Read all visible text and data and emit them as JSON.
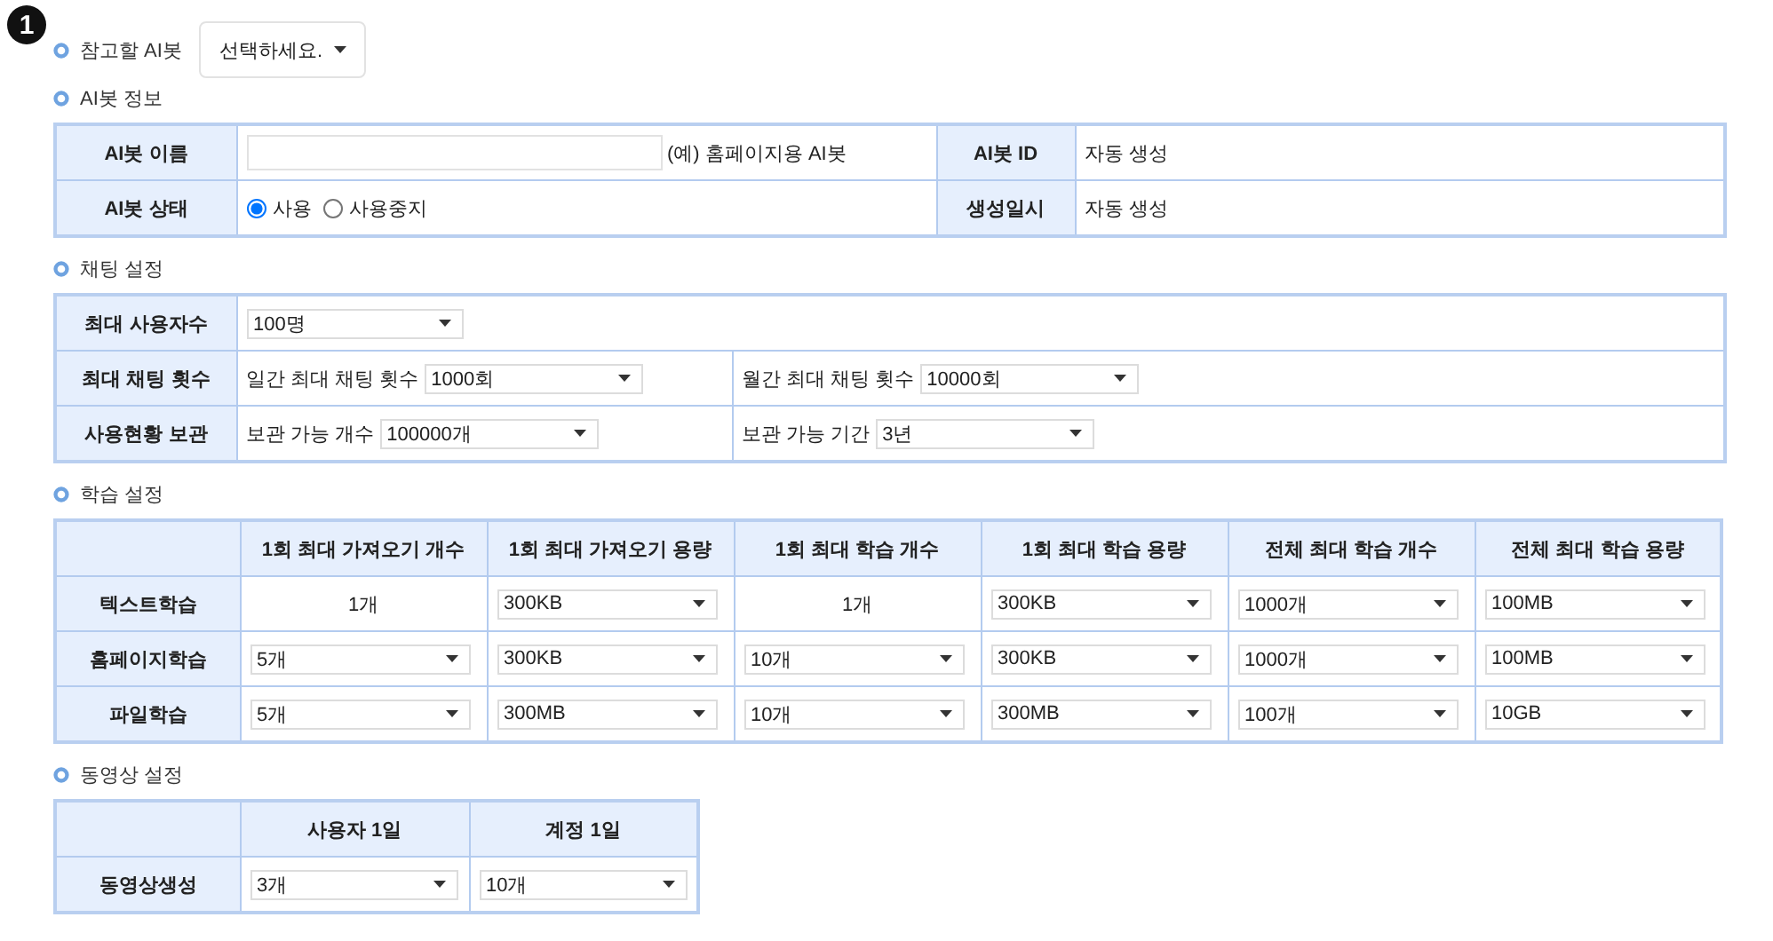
{
  "badge": "1",
  "reference": {
    "label": "참고할 AI봇",
    "dropdown": "선택하세요."
  },
  "bot_info": {
    "title": "AI봇 정보",
    "name_label": "AI봇 이름",
    "name_hint": "(예) 홈페이지용 AI봇",
    "id_label": "AI봇 ID",
    "id_value": "자동 생성",
    "status_label": "AI봇 상태",
    "status_options": [
      {
        "label": "사용",
        "selected": true
      },
      {
        "label": "사용중지",
        "selected": false
      }
    ],
    "created_label": "생성일시",
    "created_value": "자동 생성"
  },
  "chat_settings": {
    "title": "채팅 설정",
    "rows": [
      {
        "label": "최대 사용자수",
        "fields": [
          {
            "value": "100명"
          }
        ]
      },
      {
        "label": "최대 채팅 횟수",
        "fields": [
          {
            "label": "일간 최대 채팅 횟수",
            "value": "1000회"
          },
          {
            "label": "월간 최대 채팅 횟수",
            "value": "10000회"
          }
        ]
      },
      {
        "label": "사용현황 보관",
        "fields": [
          {
            "label": "보관 가능 개수",
            "value": "100000개"
          },
          {
            "label": "보관 가능 기간",
            "value": "3년"
          }
        ]
      }
    ]
  },
  "learning": {
    "title": "학습 설정",
    "columns": [
      "1회 최대 가져오기 개수",
      "1회 최대 가져오기 용량",
      "1회 최대 학습 개수",
      "1회 최대 학습 용량",
      "전체 최대 학습 개수",
      "전체 최대 학습 용량"
    ],
    "rows": [
      {
        "label": "텍스트학습",
        "cells": [
          {
            "kind": "text",
            "value": "1개"
          },
          {
            "kind": "select",
            "value": "300KB"
          },
          {
            "kind": "text",
            "value": "1개"
          },
          {
            "kind": "select",
            "value": "300KB"
          },
          {
            "kind": "select",
            "value": "1000개"
          },
          {
            "kind": "select",
            "value": "100MB"
          }
        ]
      },
      {
        "label": "홈페이지학습",
        "cells": [
          {
            "kind": "select",
            "value": "5개"
          },
          {
            "kind": "select",
            "value": "300KB"
          },
          {
            "kind": "select",
            "value": "10개"
          },
          {
            "kind": "select",
            "value": "300KB"
          },
          {
            "kind": "select",
            "value": "1000개"
          },
          {
            "kind": "select",
            "value": "100MB"
          }
        ]
      },
      {
        "label": "파일학습",
        "cells": [
          {
            "kind": "select",
            "value": "5개"
          },
          {
            "kind": "select",
            "value": "300MB"
          },
          {
            "kind": "select",
            "value": "10개"
          },
          {
            "kind": "select",
            "value": "300MB"
          },
          {
            "kind": "select",
            "value": "100개"
          },
          {
            "kind": "select",
            "value": "10GB"
          }
        ]
      }
    ]
  },
  "video": {
    "title": "동영상 설정",
    "columns": [
      "사용자 1일",
      "계정 1일"
    ],
    "rows": [
      {
        "label": "동영상생성",
        "cells": [
          {
            "kind": "select",
            "value": "3개"
          },
          {
            "kind": "select",
            "value": "10개"
          }
        ]
      }
    ]
  }
}
